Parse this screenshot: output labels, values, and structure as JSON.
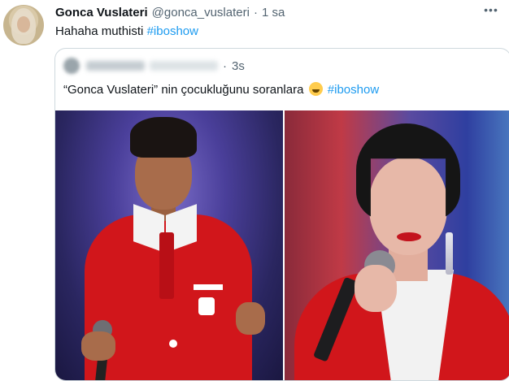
{
  "tweet": {
    "author_name": "Gonca Vuslateri",
    "handle": "@gonca_vuslateri",
    "separator": "·",
    "time": "1 sa",
    "text": "Hahaha muthisti",
    "hashtag": "#iboshow",
    "more_icon": "more-horizontal-icon",
    "more_glyph": "•••"
  },
  "quoted_tweet": {
    "separator": "·",
    "time": "3s",
    "text": "“Gonca Vuslateri” nin çocukluğunu soranlara",
    "emoji": "face-with-tears-of-joy",
    "hashtag": "#iboshow",
    "images": [
      "child-singer-photo",
      "woman-singer-photo"
    ]
  },
  "colors": {
    "link": "#1d9bf0",
    "secondary_text": "#536471",
    "border": "#cfd9de"
  }
}
